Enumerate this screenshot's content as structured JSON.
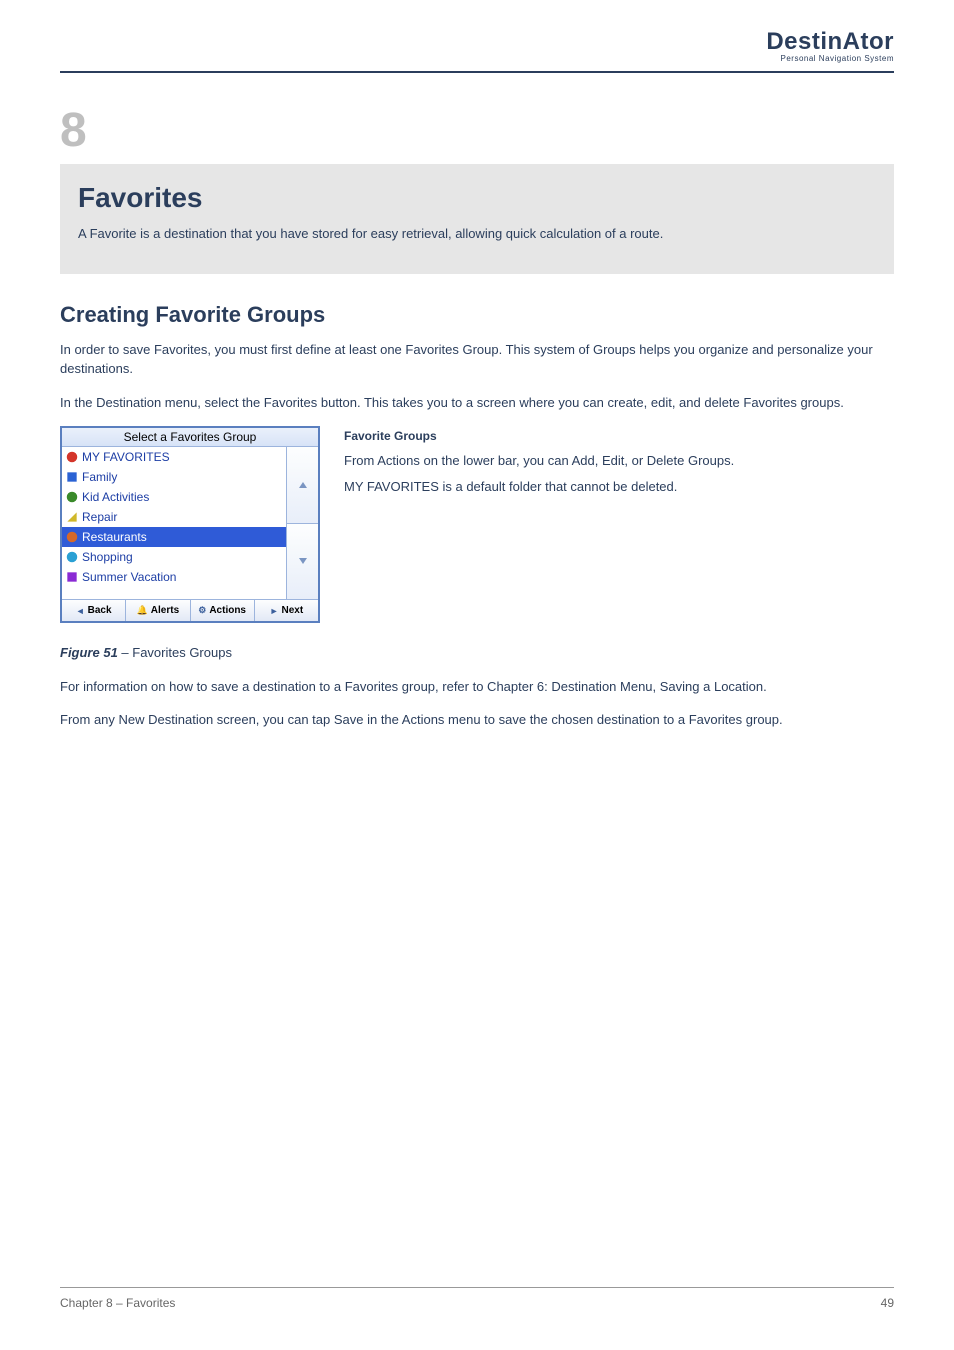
{
  "logo": {
    "main": "DestinAtor",
    "tag": "Personal Navigation System"
  },
  "chapter": {
    "number": "8",
    "title": "Favorites",
    "subtitle": "A Favorite is a destination that you have stored for easy retrieval, allowing quick calculation of a route."
  },
  "section": {
    "title": "Creating Favorite Groups",
    "p1": "In order to save Favorites, you must first define at least one Favorites Group. This system of Groups helps you organize and personalize your destinations.",
    "p2": "In the Destination menu, select the Favorites button. This takes you to a screen where you can create, edit, and delete Favorites groups."
  },
  "screenshot": {
    "title": "Select a Favorites Group",
    "items": [
      {
        "label": "MY FAVORITES",
        "iconColor": "#d4352a",
        "selected": false
      },
      {
        "label": "Family",
        "iconColor": "#2a62d4",
        "selected": false
      },
      {
        "label": "Kid Activities",
        "iconColor": "#3a8a2a",
        "selected": false
      },
      {
        "label": "Repair",
        "iconColor": "#d0b82a",
        "selected": false
      },
      {
        "label": "Restaurants",
        "iconColor": "#d4682a",
        "selected": true
      },
      {
        "label": "Shopping",
        "iconColor": "#2aa0d4",
        "selected": false
      },
      {
        "label": "Summer Vacation",
        "iconColor": "#8a2ad4",
        "selected": false
      }
    ],
    "toolbar": {
      "back": "Back",
      "alerts": "Alerts",
      "actions": "Actions",
      "next": "Next"
    }
  },
  "figure": {
    "caption_num": "Figure 51",
    "caption_text": " – Favorites Groups"
  },
  "side": {
    "label": "Favorite Groups",
    "line1": "From Actions on the lower bar, you can Add, Edit, or Delete Groups.",
    "line2": "MY FAVORITES is a default folder that cannot be deleted."
  },
  "below": {
    "p1": "For information on how to save a destination to a Favorites group, refer to Chapter 6: Destination Menu, Saving a Location.",
    "p2": "From any New Destination screen, you can tap Save in the Actions menu to save the chosen destination to a Favorites group."
  },
  "footer": {
    "left": "Chapter 8 – Favorites",
    "right": "49"
  }
}
